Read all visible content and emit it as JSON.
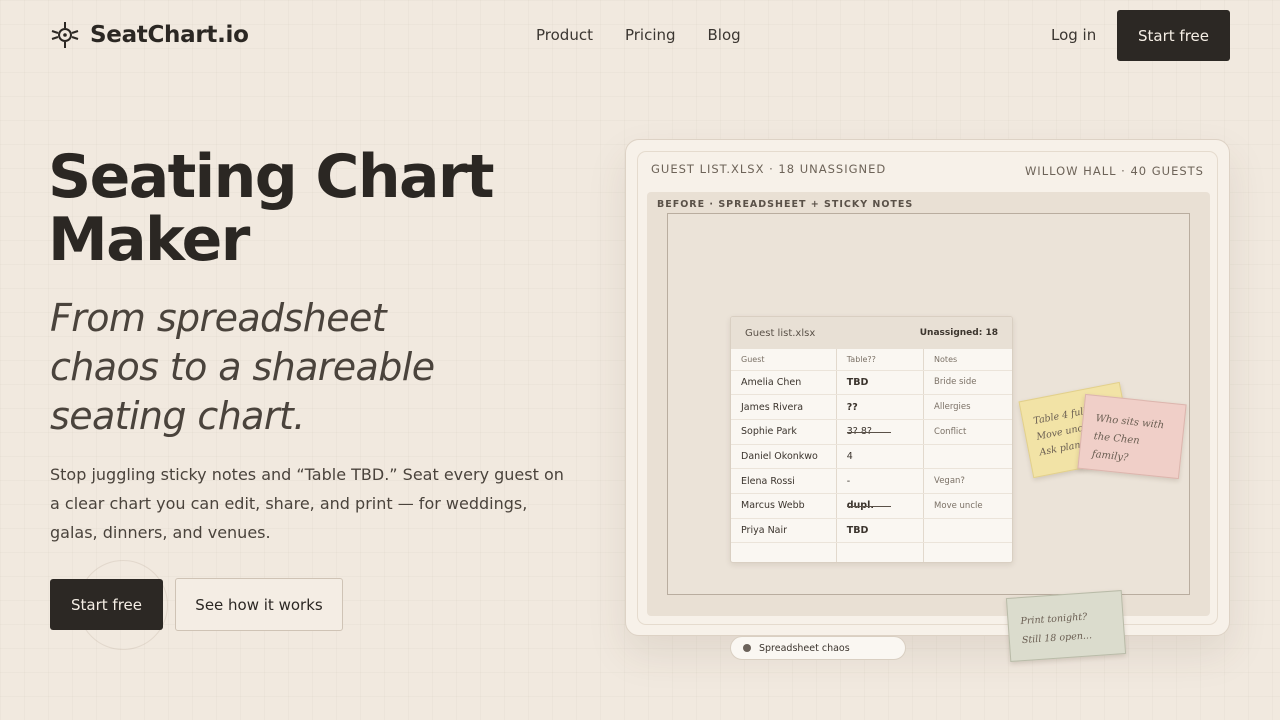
{
  "nav": {
    "brand": "SeatChart.io",
    "logo_icon": "seat-chart-logo-icon",
    "links": [
      "Product",
      "Pricing",
      "Blog"
    ],
    "login": "Log in",
    "cta": "Start free"
  },
  "hero": {
    "title_line1": "Seating Chart",
    "title_line2": "Maker",
    "subtitle_line1": "From spreadsheet",
    "subtitle_line2": "chaos to a shareable",
    "subtitle_line3": "seating chart.",
    "body": "Stop juggling sticky notes and “Table TBD.” Seat every guest on a clear chart you can edit, share, and print — for weddings, galas, dinners, and venues.",
    "cta_primary": "Start free",
    "cta_secondary": "See how it works"
  },
  "preview": {
    "meta_left": "GUEST LIST.XLSX · 18 UNASSIGNED",
    "meta_right": "WILLOW HALL · 40 GUESTS",
    "stage_label": "BEFORE · SPREADSHEET + STICKY NOTES",
    "sheet": {
      "title": "Guest list.xlsx",
      "unassigned": "Unassigned: 18",
      "columns": [
        "Guest",
        "Table??",
        "Notes"
      ],
      "rows": [
        {
          "guest": "Amelia Chen",
          "table": "TBD",
          "notes": "Bride side"
        },
        {
          "guest": "James Rivera",
          "table": "??",
          "notes": "Allergies"
        },
        {
          "guest": "Sophie Park",
          "table": "3? 8?",
          "notes": "Conflict"
        },
        {
          "guest": "Daniel Okonkwo",
          "table": "4",
          "notes": ""
        },
        {
          "guest": "Elena Rossi",
          "table": "-",
          "notes": "Vegan?"
        },
        {
          "guest": "Marcus Webb",
          "table": "dupl.",
          "notes": "Move uncle"
        },
        {
          "guest": "Priya Nair",
          "table": "TBD",
          "notes": ""
        }
      ]
    },
    "notes": {
      "yellow_line1": "Table 4 full",
      "yellow_line2": "Move uncle",
      "yellow_line3": "Ask plan",
      "pink_line1": "Who sits with",
      "pink_line2": "the Chen family?",
      "green_line1": "Print tonight?",
      "green_line2": "Still 18 open..."
    },
    "status_pill": "Spreadsheet chaos"
  }
}
